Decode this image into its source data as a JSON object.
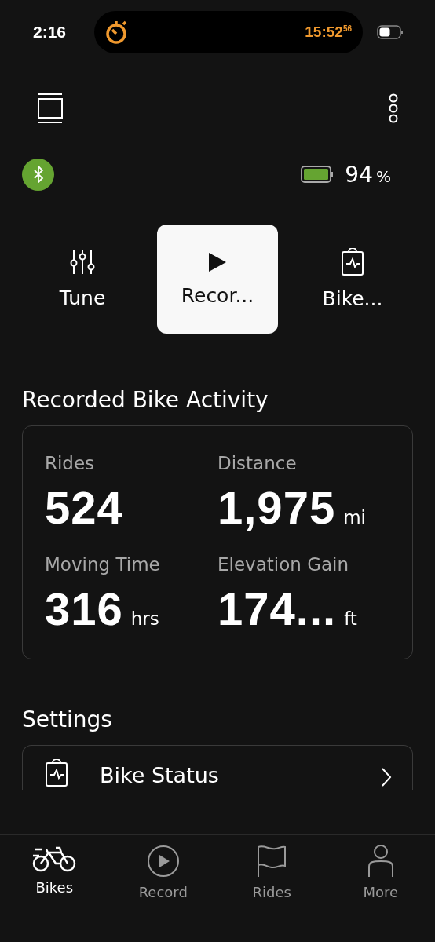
{
  "status_bar": {
    "time": "2:16",
    "timer": "15:52",
    "timer_seconds": "56"
  },
  "bike": {
    "battery_percent": "94",
    "percent_sign": "%"
  },
  "actions": [
    {
      "kind": "tune",
      "label": "Tune",
      "selected": false
    },
    {
      "kind": "record",
      "label": "Recor...",
      "selected": true
    },
    {
      "kind": "status",
      "label": "Bike...",
      "selected": false
    }
  ],
  "activity": {
    "title": "Recorded Bike Activity",
    "stats": [
      {
        "label": "Rides",
        "value": "524"
      },
      {
        "label": "Distance",
        "value": "1,975",
        "unit": "mi"
      },
      {
        "label": "Moving Time",
        "value": "316",
        "unit": "hrs"
      },
      {
        "label": "Elevation Gain",
        "value": "174...",
        "unit": "ft"
      }
    ]
  },
  "settings": {
    "title": "Settings",
    "items": [
      {
        "kind": "status",
        "label": "Bike Status"
      }
    ]
  },
  "tab_bar": [
    {
      "kind": "bikes",
      "label": "Bikes",
      "selected": true
    },
    {
      "kind": "record",
      "label": "Record",
      "selected": false
    },
    {
      "kind": "rides",
      "label": "Rides",
      "selected": false
    },
    {
      "kind": "more",
      "label": "More",
      "selected": false
    }
  ]
}
